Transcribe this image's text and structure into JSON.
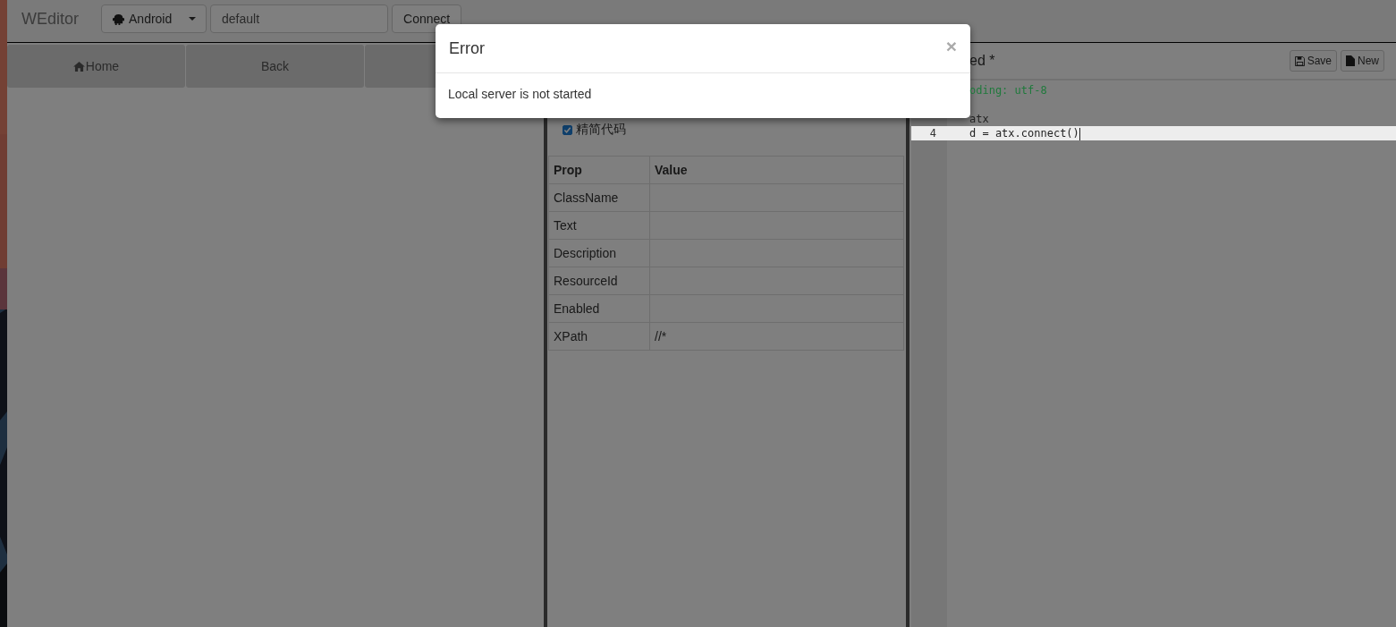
{
  "navbar": {
    "brand": "WEditor",
    "platform": {
      "label": "Android"
    },
    "device_field": {
      "value": "default"
    },
    "connect_button": "Connect"
  },
  "device_toolbar": {
    "buttons": [
      {
        "label": "Home",
        "kind": "home"
      },
      {
        "label": "Back",
        "kind": "plain"
      },
      {
        "kind": "plain"
      }
    ]
  },
  "inspector": {
    "options": [
      {
        "label": "精简代码",
        "checked": true
      }
    ],
    "table": {
      "columns": [
        "Prop",
        "Value"
      ],
      "rows": [
        {
          "prop": "ClassName"
        },
        {
          "prop": "Text"
        },
        {
          "prop": "Description"
        },
        {
          "prop": "ResourceId"
        },
        {
          "prop": "Enabled"
        },
        {
          "prop": "XPath",
          "value": "//*"
        }
      ]
    }
  },
  "editor": {
    "title": "ed *",
    "buttons": [
      {
        "label": "Save",
        "kind": "save"
      },
      {
        "label": "New",
        "kind": "new"
      }
    ],
    "lines": [
      {
        "active": false,
        "tokens": [
          {
            "text": "oding: utf-8",
            "kind": "comment"
          }
        ]
      },
      {
        "active": false
      },
      {
        "active": false,
        "tokens": [
          {
            "text": "atx",
            "kind": "plain"
          }
        ]
      },
      {
        "active": true,
        "number": "4",
        "tokens": [
          {
            "text": "d = atx.connect()",
            "kind": "plain"
          }
        ]
      }
    ]
  },
  "modal": {
    "title": "Error",
    "close": "×",
    "message": "Local server is not started"
  }
}
